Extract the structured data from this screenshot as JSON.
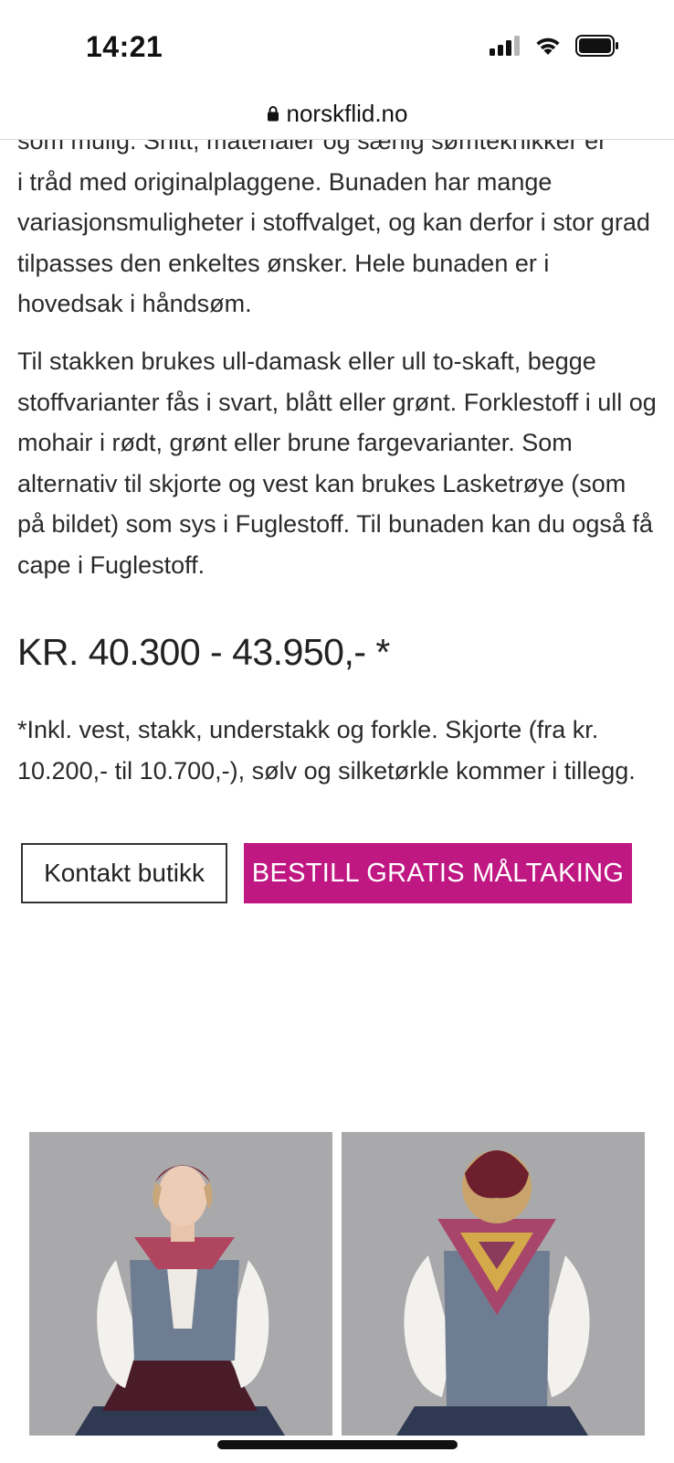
{
  "status_bar": {
    "time": "14:21"
  },
  "browser": {
    "url": "norskflid.no"
  },
  "content": {
    "partial_line": "som mulig.  Snitt, materialer og særlig sømteknikker er",
    "paragraph_1": "i tråd med originalplaggene.  Bunaden har mange variasjonsmuligheter i stoffvalget, og kan derfor i stor grad tilpasses den enkeltes ønsker. Hele bunaden er i hovedsak i håndsøm.",
    "paragraph_2": "Til stakken brukes ull-damask eller ull to-skaft, begge stoffvarianter fås i svart, blått eller grønt.  Forklestoff i ull og mohair i rødt, grønt eller brune fargevarianter. Som alternativ til skjorte og vest kan brukes Lasketrøye (som på bildet) som sys i Fuglestoff. Til bunaden kan du også få cape i Fuglestoff.",
    "price": "KR. 40.300 - 43.950,- *",
    "price_note": "*Inkl. vest, stakk, understakk og forkle. Skjorte (fra kr. 10.200,- til 10.700,-), sølv og silketørkle kommer i tillegg."
  },
  "actions": {
    "contact_label": "Kontakt butikk",
    "order_label": "BESTILL GRATIS MÅLTAKING"
  },
  "colors": {
    "accent": "#c01883",
    "photo_background": "#a9a9ab"
  },
  "icons": [
    "signal-icon",
    "wifi-icon",
    "battery-icon",
    "lock-icon"
  ]
}
